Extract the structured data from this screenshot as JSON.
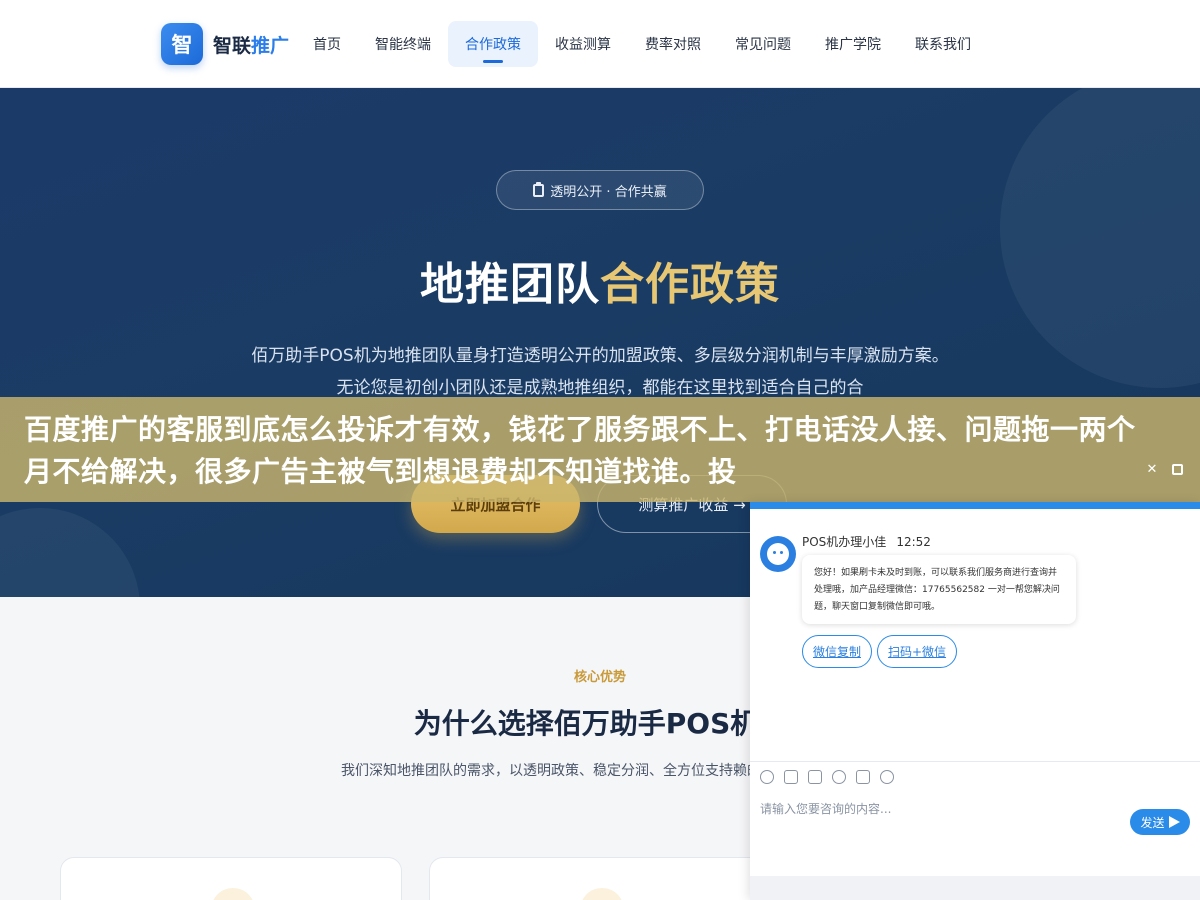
{
  "header": {
    "logo_badge": "智",
    "logo_main": "智联",
    "logo_accent": "推广",
    "nav": [
      {
        "label": "首页"
      },
      {
        "label": "智能终端"
      },
      {
        "label": "合作政策",
        "active": true
      },
      {
        "label": "收益测算"
      },
      {
        "label": "费率对照"
      },
      {
        "label": "常见问题"
      },
      {
        "label": "推广学院"
      },
      {
        "label": "联系我们"
      }
    ]
  },
  "hero": {
    "badge": "透明公开 · 合作共赢",
    "title_main": "地推团队",
    "title_accent": "合作政策",
    "description": "佰万助手POS机为地推团队量身打造透明公开的加盟政策、多层级分润机制与丰厚激励方案。无论您是初创小团队还是成熟地推组织，都能在这里找到适合自己的合",
    "primary_button": "立即加盟合作",
    "secondary_button": "测算推广收益 →"
  },
  "advantages": {
    "tag": "核心优势",
    "title": "为什么选择佰万助手POS机合",
    "description": "我们深知地推团队的需求，以透明政策、稳定分润、全方位支持赖的长期合作关系。"
  },
  "overlay": {
    "text": "百度推广的客服到底怎么投诉才有效，钱花了服务跟不上、打电话没人接、问题拖一两个月不给解决，很多广告主被气到想退费却不知道找谁。投",
    "close_glyph": "✕"
  },
  "chat": {
    "sender": "POS机办理小佳",
    "time": "12:52",
    "message": "您好！如果刷卡未及时到账，可以联系我们服务商进行查询并处理哦，加产品经理微信：17765562582 一对一帮您解决问题，聊天窗口复制微信即可哦。",
    "chips": [
      "微信复制",
      "扫码+微信"
    ],
    "input_placeholder": "请输入您要咨询的内容...",
    "send_label": "发送",
    "accent_color": "#2a8be8"
  }
}
